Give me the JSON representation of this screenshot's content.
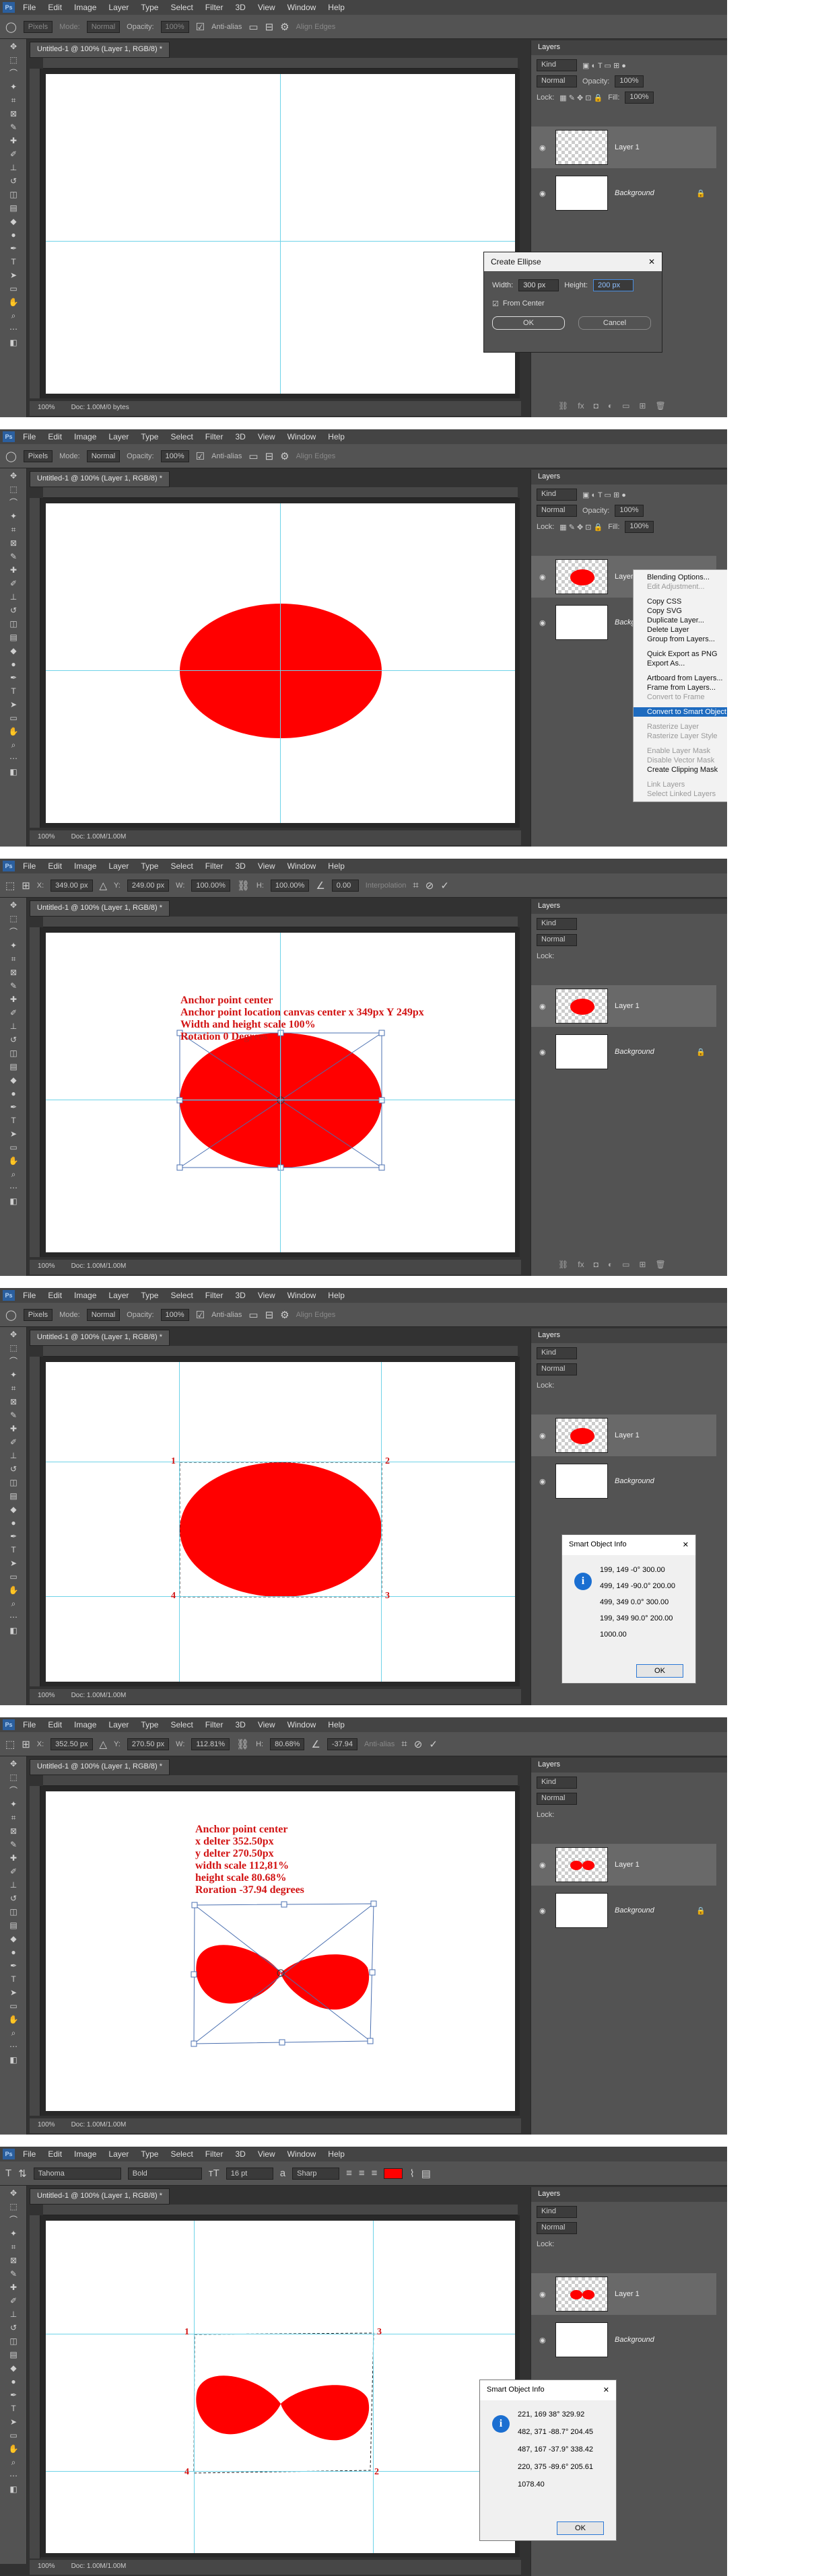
{
  "menu": {
    "app": "Ps",
    "items": [
      "File",
      "Edit",
      "Image",
      "Layer",
      "Type",
      "Select",
      "Filter",
      "3D",
      "View",
      "Window",
      "Help"
    ]
  },
  "optbar_shape": {
    "pixels": "Pixels",
    "mode_label": "Mode:",
    "mode": "Normal",
    "opacity_label": "Opacity:",
    "opacity": "100%",
    "antialias": "Anti-alias",
    "align_edges": "Align Edges"
  },
  "optbar_transform1": {
    "x_label": "X:",
    "x": "349.00 px",
    "y_label": "Y:",
    "y": "249.00 px",
    "w_label": "W:",
    "w": "100.00%",
    "h_label": "H:",
    "h": "100.00%",
    "angle": "0.00",
    "interp": "Interpolation"
  },
  "optbar_transform2": {
    "x_label": "X:",
    "x": "352.50 px",
    "y_label": "Y:",
    "y": "270.50 px",
    "w_label": "W:",
    "w": "112.81%",
    "h_label": "H:",
    "h": "80.68%",
    "angle": "-37.94",
    "interp": "Anti-alias"
  },
  "optbar_type": {
    "font": "Tahoma",
    "style": "Bold",
    "size": "16 pt",
    "aa": "Sharp"
  },
  "doc_tab": "Untitled-1 @ 100% (Layer 1, RGB/8) *",
  "status": {
    "zoom": "100%",
    "doc_a": "Doc: 1.00M/0 bytes",
    "doc_b": "Doc: 1.00M/1.00M"
  },
  "layers_panel": {
    "title": "Layers",
    "kind": "Kind",
    "blend": "Normal",
    "opacity_label": "Opacity:",
    "opacity": "100%",
    "lock_label": "Lock:",
    "fill_label": "Fill:",
    "fill": "100%",
    "layer1": "Layer 1",
    "background": "Background"
  },
  "create_ellipse": {
    "title": "Create Ellipse",
    "width_label": "Width:",
    "width": "300 px",
    "height_label": "Height:",
    "height": "200 px",
    "from_center": "From Center",
    "ok": "OK",
    "cancel": "Cancel"
  },
  "context_menu": {
    "items": [
      {
        "label": "Blending Options...",
        "state": "normal"
      },
      {
        "label": "Edit Adjustment...",
        "state": "disabled"
      },
      {
        "label": "",
        "state": "sep"
      },
      {
        "label": "Copy CSS",
        "state": "normal"
      },
      {
        "label": "Copy SVG",
        "state": "normal"
      },
      {
        "label": "Duplicate Layer...",
        "state": "normal"
      },
      {
        "label": "Delete Layer",
        "state": "normal"
      },
      {
        "label": "Group from Layers...",
        "state": "normal"
      },
      {
        "label": "",
        "state": "sep"
      },
      {
        "label": "Quick Export as PNG",
        "state": "normal"
      },
      {
        "label": "Export As...",
        "state": "normal"
      },
      {
        "label": "",
        "state": "sep"
      },
      {
        "label": "Artboard from Layers...",
        "state": "normal"
      },
      {
        "label": "Frame from Layers...",
        "state": "normal"
      },
      {
        "label": "Convert to Frame",
        "state": "disabled"
      },
      {
        "label": "",
        "state": "sep"
      },
      {
        "label": "Convert to Smart Object",
        "state": "highlight"
      },
      {
        "label": "",
        "state": "sep"
      },
      {
        "label": "Rasterize Layer",
        "state": "disabled"
      },
      {
        "label": "Rasterize Layer Style",
        "state": "disabled"
      },
      {
        "label": "",
        "state": "sep"
      },
      {
        "label": "Enable Layer Mask",
        "state": "disabled"
      },
      {
        "label": "Disable Vector Mask",
        "state": "disabled"
      },
      {
        "label": "Create Clipping Mask",
        "state": "normal"
      },
      {
        "label": "",
        "state": "sep"
      },
      {
        "label": "Link Layers",
        "state": "disabled"
      },
      {
        "label": "Select Linked Layers",
        "state": "disabled"
      }
    ]
  },
  "annotation1": [
    "Anchor point center",
    "Anchor point location canvas center x 349px Y 249px",
    "Width and height scale 100%",
    "Rotation 0 Degrees"
  ],
  "annotation2": [
    "Anchor point center",
    "x delter 352.50px",
    "y delter 270.50px",
    "width scale 112,81%",
    "height scale 80.68%",
    "Roration -37.94 degrees"
  ],
  "info1": {
    "title": "Smart Object Info",
    "lines": [
      "199, 149 -0° 300.00",
      "499, 149 -90.0° 200.00",
      "499, 349 0.0° 300.00",
      "199, 349 90.0° 200.00",
      "1000.00"
    ],
    "ok": "OK"
  },
  "info2": {
    "title": "Smart Object Info",
    "lines": [
      "221, 169 38° 329.92",
      "482, 371 -88.7° 204.45",
      "487, 167 -37.9° 338.42",
      "220, 375 -89.6° 205.61",
      "1078.40"
    ],
    "ok": "OK"
  },
  "corner_labels": [
    "1",
    "2",
    "3",
    "4"
  ],
  "colors": {
    "red": "#ff0000",
    "guide": "#6ed3e8",
    "accent": "#1e6bbf"
  }
}
